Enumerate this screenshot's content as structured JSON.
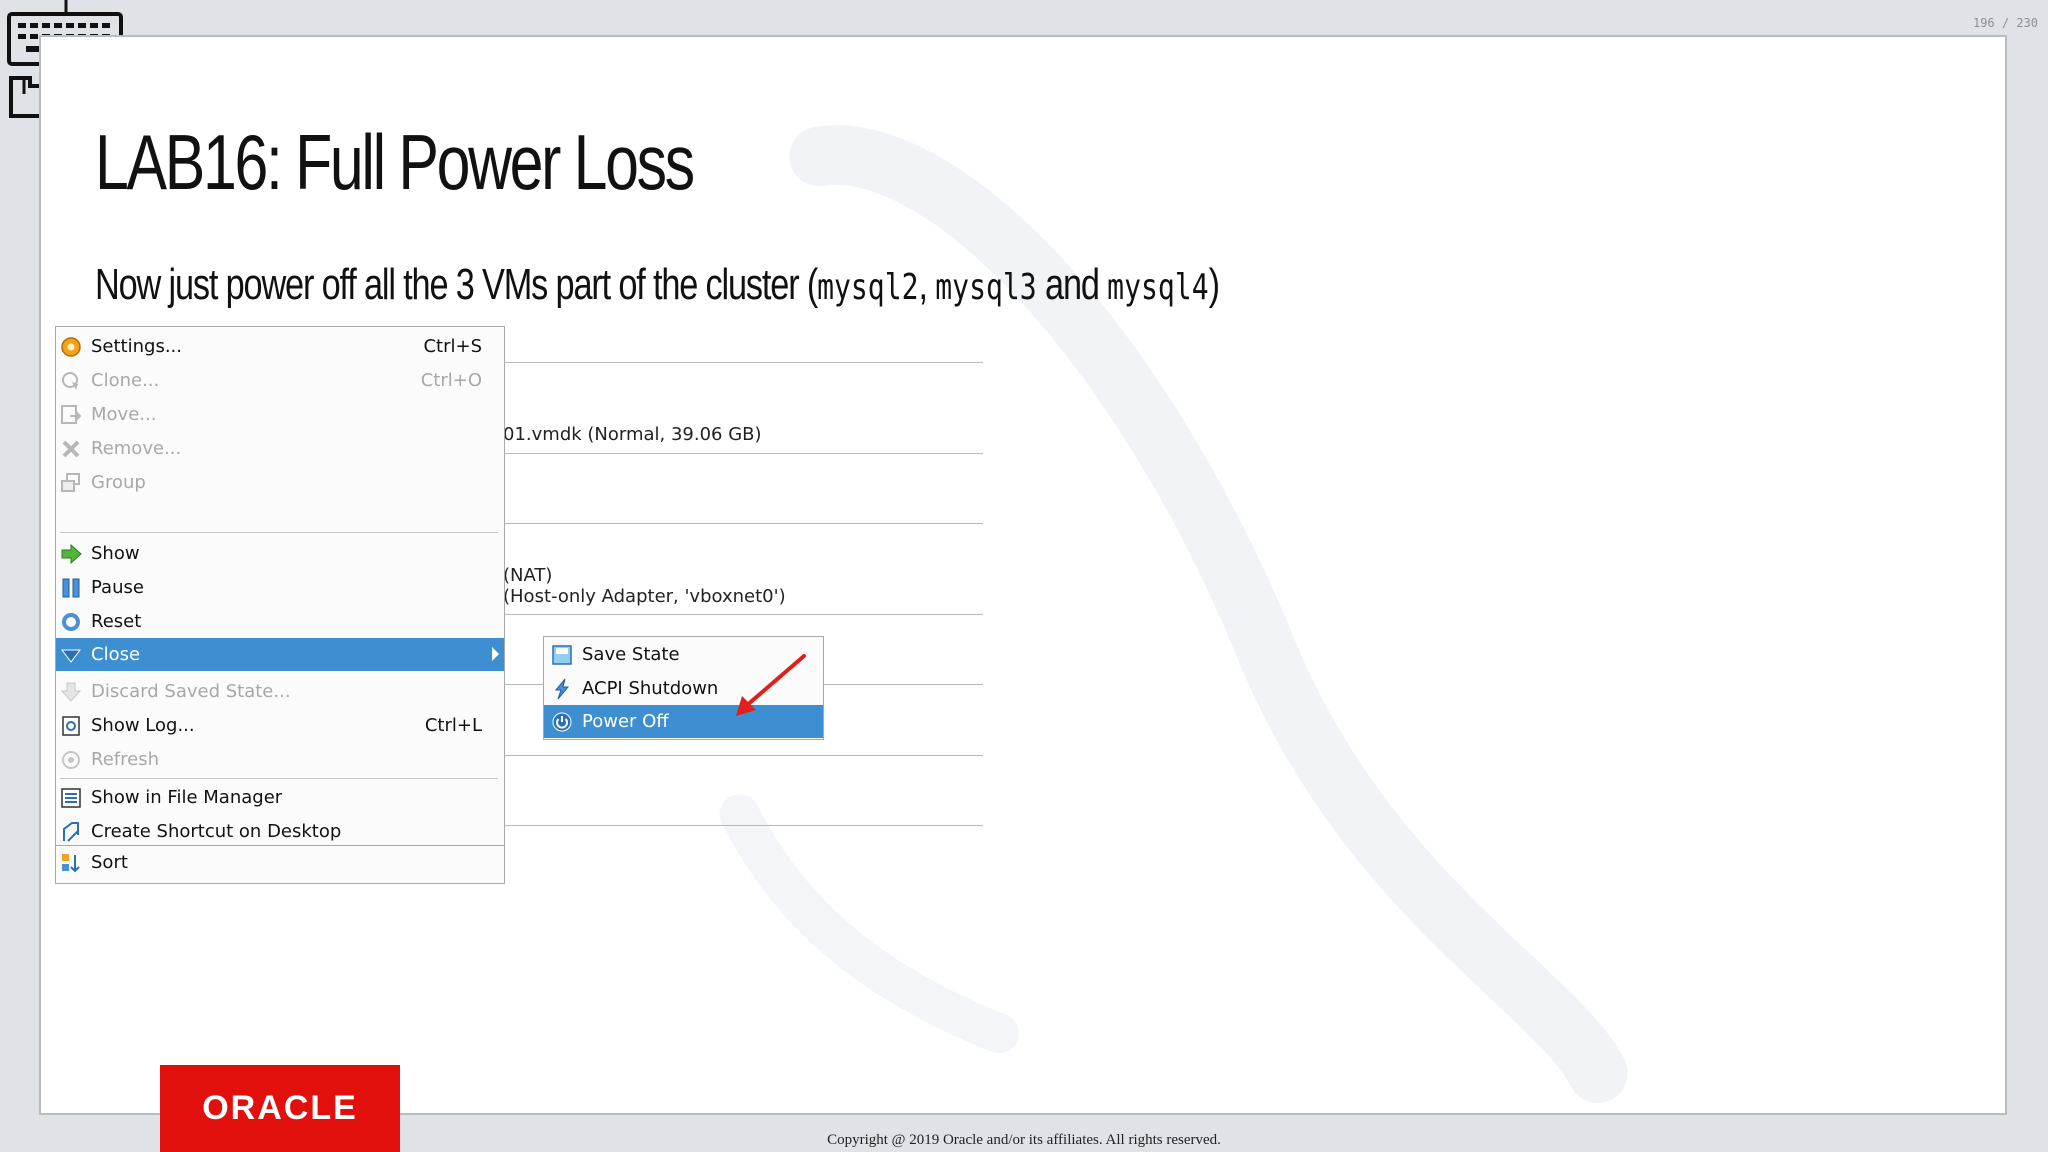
{
  "page_counter": "196 / 230",
  "slide": {
    "title": "LAB16: Full Power Loss",
    "subtitle_pre": "Now just power off all the 3 VMs part of the cluster (",
    "vm1": "mysql2",
    "sep1": ", ",
    "vm2": "mysql3",
    "sep2": " and ",
    "vm3": "mysql4",
    "subtitle_post": ")"
  },
  "vbox_bg": {
    "disk_line": "01.vmdk (Normal, 39.06 GB)",
    "nat_line": "(NAT)",
    "hostonly_line": "(Host-only Adapter, 'vboxnet0')"
  },
  "menu": {
    "items": [
      {
        "label": "Settings...",
        "shortcut": "Ctrl+S",
        "icon": "settings-icon"
      },
      {
        "label": "Clone...",
        "shortcut": "Ctrl+O",
        "icon": "clone-icon"
      },
      {
        "label": "Move...",
        "shortcut": "",
        "icon": "move-icon"
      },
      {
        "label": "Remove...",
        "shortcut": "",
        "icon": "remove-icon"
      },
      {
        "label": "Group",
        "shortcut": "",
        "icon": "group-icon"
      },
      {
        "label": "Show",
        "shortcut": "",
        "icon": "show-arrow-icon"
      },
      {
        "label": "Pause",
        "shortcut": "",
        "icon": "pause-icon"
      },
      {
        "label": "Reset",
        "shortcut": "",
        "icon": "reset-icon"
      },
      {
        "label": "Close",
        "shortcut": "",
        "icon": "close-down-icon"
      },
      {
        "label": "Discard Saved State...",
        "shortcut": "",
        "icon": "discard-icon"
      },
      {
        "label": "Show Log...",
        "shortcut": "Ctrl+L",
        "icon": "log-icon"
      },
      {
        "label": "Refresh",
        "shortcut": "",
        "icon": "refresh-icon"
      },
      {
        "label": "Show in File Manager",
        "shortcut": "",
        "icon": "file-manager-icon"
      },
      {
        "label": "Create Shortcut on Desktop",
        "shortcut": "",
        "icon": "shortcut-icon"
      },
      {
        "label": "Sort",
        "shortcut": "",
        "icon": "sort-icon"
      }
    ]
  },
  "submenu": {
    "items": [
      {
        "label": "Save State",
        "icon": "save-state-icon"
      },
      {
        "label": "ACPI Shutdown",
        "icon": "acpi-shutdown-icon"
      },
      {
        "label": "Power Off",
        "icon": "power-off-icon"
      }
    ]
  },
  "footer": {
    "logo_text": "ORACLE",
    "copyright": "Copyright @ 2019 Oracle and/or its affiliates. All rights reserved."
  },
  "colors": {
    "highlight": "#3d8fd1",
    "oracle_red": "#e2100c",
    "annotation_arrow": "#e0201a"
  }
}
